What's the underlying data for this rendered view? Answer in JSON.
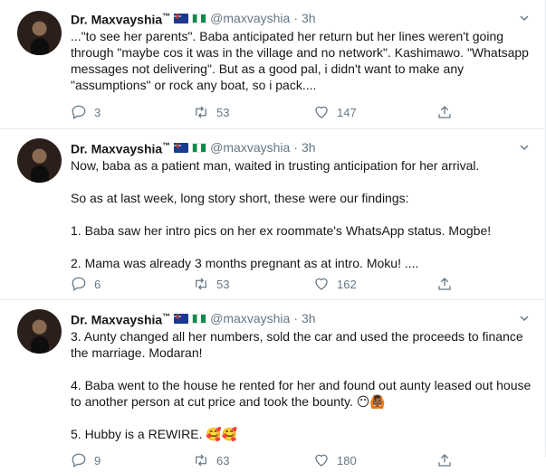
{
  "tweets": [
    {
      "name": "Dr. Maxvayshia",
      "tm": "™",
      "handle": "@maxvayshia",
      "sep": "·",
      "time": "3h",
      "paragraphs": [
        "...\"to see her parents\". Baba anticipated her return but her lines weren't going through \"maybe cos it was in the village and no network\". Kashimawo. \"Whatsapp messages not delivering\". But as a good pal, i didn't want to make any \"assumptions\" or rock any boat, so i pack...."
      ],
      "replies": "3",
      "retweets": "53",
      "likes": "147"
    },
    {
      "name": "Dr. Maxvayshia",
      "tm": "™",
      "handle": "@maxvayshia",
      "sep": "·",
      "time": "3h",
      "paragraphs": [
        "Now, baba as a patient man, waited in trusting anticipation for her arrival.",
        "So as at last week, long story short, these were our findings:",
        "1. Baba saw her intro pics on her ex roommate's WhatsApp status. Mogbe!",
        "2. Mama was already 3 months pregnant as at intro. Moku! ...."
      ],
      "replies": "6",
      "retweets": "53",
      "likes": "162"
    },
    {
      "name": "Dr. Maxvayshia",
      "tm": "™",
      "handle": "@maxvayshia",
      "sep": "·",
      "time": "3h",
      "paragraphs": [
        "3. Aunty changed all her numbers, sold the car and used the proceeds to finance the marriage. Modaran!",
        "4. Baba went to the house he rented for her and found out aunty leased out house to another person at cut price and took the bounty.",
        "5. Hubby is a REWIRE."
      ],
      "emoji_p4": "😶🙆🏾",
      "emoji_p5": "🥰🥰",
      "replies": "9",
      "retweets": "63",
      "likes": "180"
    }
  ],
  "icons": [
    "reply-icon",
    "retweet-icon",
    "like-icon",
    "share-icon",
    "chevron-down-icon"
  ],
  "colors": {
    "text": "#14171a",
    "muted": "#657786",
    "border": "#e6ecf0"
  }
}
